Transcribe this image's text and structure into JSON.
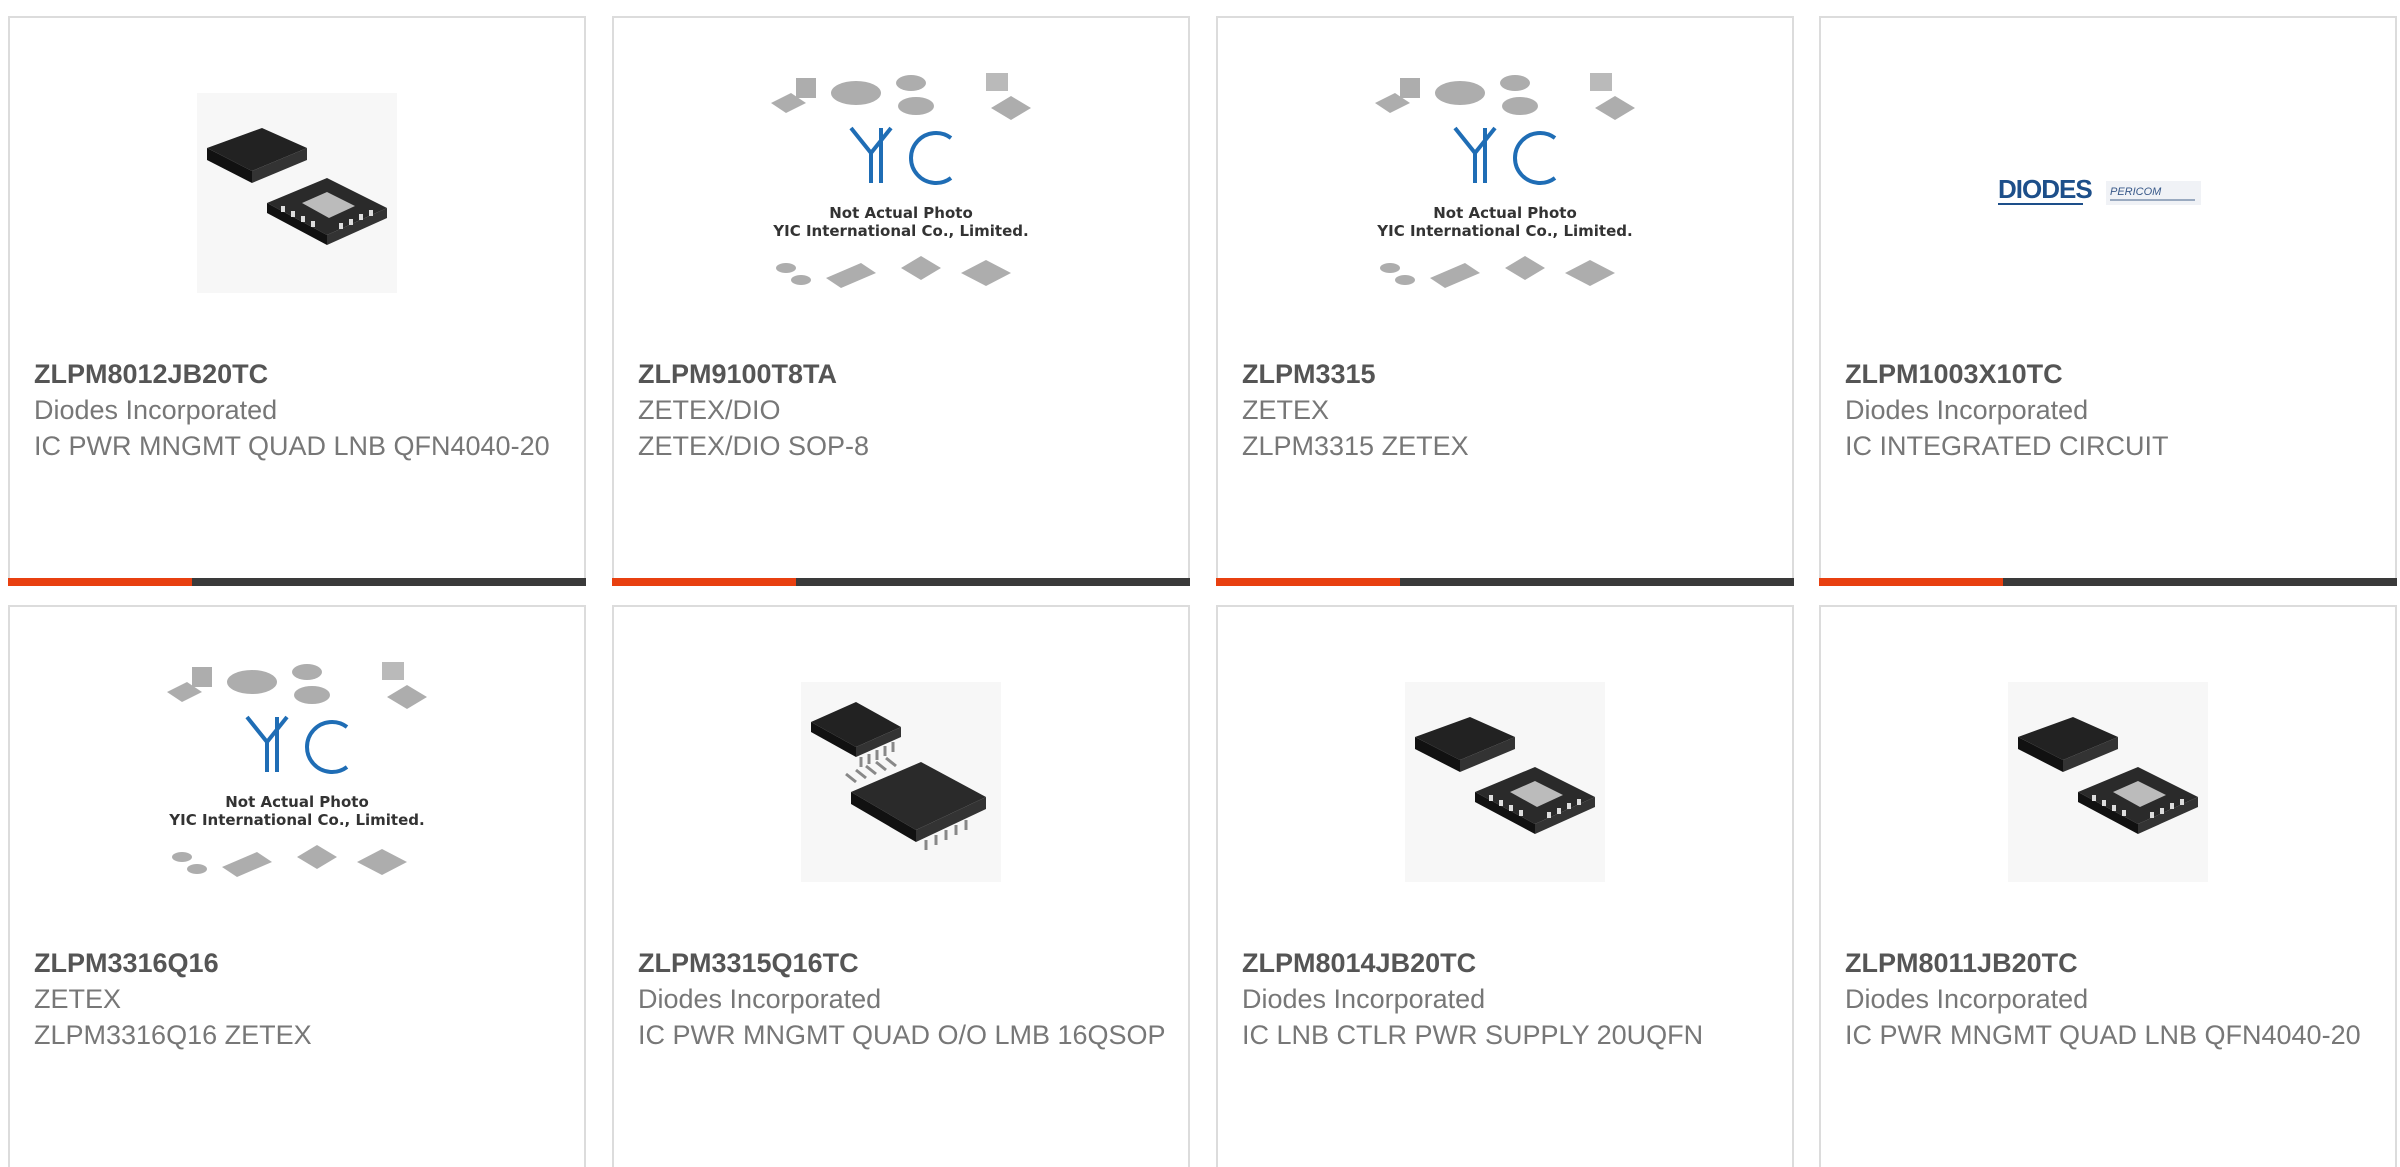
{
  "colors": {
    "accent": "#e84010",
    "bar": "#3a3a3a",
    "border": "#dcdcdc",
    "part_number": "#555555",
    "text": "#777777",
    "yic_blue": "#1f6db5"
  },
  "products": [
    {
      "part_number": "ZLPM8012JB20TC",
      "manufacturer": "Diodes Incorporated",
      "description": "IC PWR MNGMT QUAD LNB QFN4040-20",
      "image": "qfn-chip-photo"
    },
    {
      "part_number": "ZLPM9100T8TA",
      "manufacturer": "ZETEX/DIO",
      "description": "ZETEX/DIO SOP-8",
      "image": "yic-placeholder"
    },
    {
      "part_number": "ZLPM3315",
      "manufacturer": "ZETEX",
      "description": "ZLPM3315 ZETEX",
      "image": "yic-placeholder"
    },
    {
      "part_number": "ZLPM1003X10TC",
      "manufacturer": "Diodes Incorporated",
      "description": "IC INTEGRATED CIRCUIT",
      "image": "diodes-pericom-logo"
    },
    {
      "part_number": "ZLPM3316Q16",
      "manufacturer": "ZETEX",
      "description": "ZLPM3316Q16 ZETEX",
      "image": "yic-placeholder"
    },
    {
      "part_number": "ZLPM3315Q16TC",
      "manufacturer": "Diodes Incorporated",
      "description": "IC PWR MNGMT QUAD O/O LMB 16QSOP",
      "image": "qsop-chip-photo"
    },
    {
      "part_number": "ZLPM8014JB20TC",
      "manufacturer": "Diodes Incorporated",
      "description": "IC LNB CTLR PWR SUPPLY 20UQFN",
      "image": "qfn-chip-photo"
    },
    {
      "part_number": "ZLPM8011JB20TC",
      "manufacturer": "Diodes Incorporated",
      "description": "IC PWR MNGMT QUAD LNB QFN4040-20",
      "image": "qfn-chip-photo"
    }
  ],
  "placeholder": {
    "line1": "Not Actual Photo",
    "line2": "YIC International Co., Limited."
  },
  "logos": {
    "diodes": "DIODES",
    "pericom": "PERICOM"
  }
}
